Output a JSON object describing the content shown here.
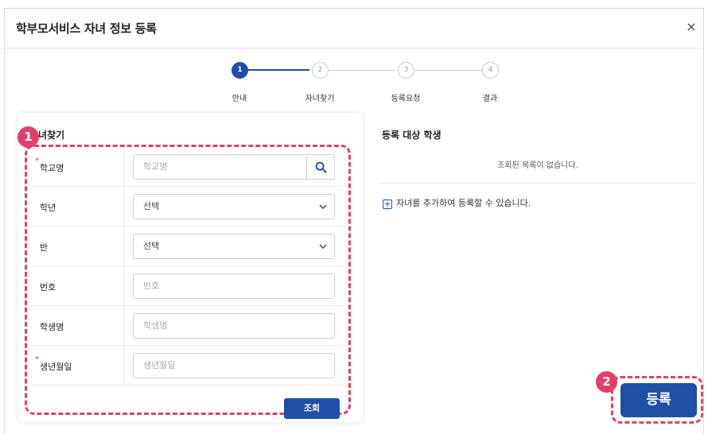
{
  "modal": {
    "title": "학부모서비스 자녀 정보 등록",
    "close_icon": "close-icon",
    "close_glyph": "×"
  },
  "stepper": {
    "steps": [
      {
        "number": "1",
        "label": "안내",
        "active": true
      },
      {
        "number": "2",
        "label": "자녀찾기",
        "active": false
      },
      {
        "number": "3",
        "label": "등록요청",
        "active": false
      },
      {
        "number": "4",
        "label": "결과",
        "active": false
      }
    ]
  },
  "left": {
    "title": "자녀찾기",
    "fields": {
      "school": {
        "label": "학교명",
        "placeholder": "학교명",
        "required": true
      },
      "grade": {
        "label": "학년",
        "value": "선택"
      },
      "class": {
        "label": "반",
        "value": "선택"
      },
      "number": {
        "label": "번호",
        "placeholder": "번호"
      },
      "student_name": {
        "label": "학생명",
        "placeholder": "학생명"
      },
      "birthdate": {
        "label": "생년월일",
        "placeholder": "생년월일",
        "required": true
      }
    },
    "lookup_label": "조회",
    "required_mark": "*"
  },
  "right": {
    "title": "등록 대상 학생",
    "empty_message": "조회된 목록이 없습니다.",
    "add_hint": "자녀를 추가하여 등록할 수 있습니다.",
    "plus_glyph": "+"
  },
  "register_label": "등록",
  "badges": {
    "form": "1",
    "register": "2"
  },
  "colors": {
    "primary": "#1e4fa3",
    "highlight": "#e0406b",
    "required": "#e03b3b"
  }
}
